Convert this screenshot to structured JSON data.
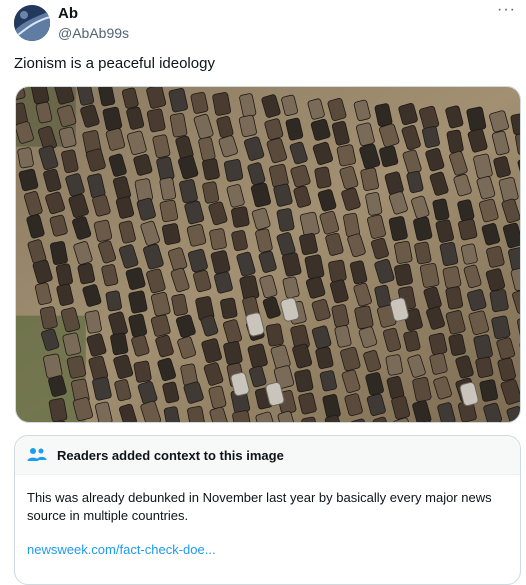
{
  "author": {
    "display_name": "Ab",
    "handle": "@AbAb99s",
    "avatar_icon": "avatar-image"
  },
  "header": {
    "more_icon": "ellipsis-icon",
    "more_glyph": "···"
  },
  "tweet": {
    "text": "Zionism is a peaceful ideology",
    "media_description_icon": "photo"
  },
  "community_note": {
    "icon": "people-icon",
    "title": "Readers added context to this image",
    "body": "This was already debunked in November last year by basically every major news source in multiple countries.",
    "link_text": "newsweek.com/fact-check-doe..."
  },
  "colors": {
    "text_primary": "#0f1419",
    "text_secondary": "#536471",
    "link": "#1d9bf0",
    "border": "#cfd9de",
    "note_header_bg": "#f7f9f9"
  }
}
